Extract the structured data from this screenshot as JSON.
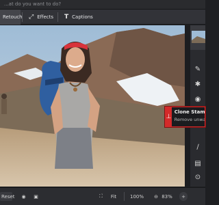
{
  "search": {
    "placeholder": "...at do you want to do?"
  },
  "tabs": [
    {
      "label": "Retouch",
      "icon": "retouch-icon"
    },
    {
      "label": "Effects",
      "icon": "magic-wand-icon"
    },
    {
      "label": "Captions",
      "icon": "text-icon"
    }
  ],
  "tools": [
    {
      "name": "pin-tool",
      "glyph": "✎"
    },
    {
      "name": "sticker-tool",
      "glyph": "✱"
    },
    {
      "name": "eye-tool",
      "glyph": "◉"
    },
    {
      "name": "clone-stamp-tool",
      "glyph": "⊥"
    },
    {
      "name": "brush-tool",
      "glyph": "∕"
    },
    {
      "name": "panel-tool",
      "glyph": "▤"
    },
    {
      "name": "rotate-tool",
      "glyph": "⊙"
    }
  ],
  "tooltip": {
    "title": "Clone Stamp",
    "desc": "Remove unwanted objects",
    "icon": "stamp-icon"
  },
  "bottom": {
    "reset": "Reset",
    "fit": "Fit",
    "hundred": "100%",
    "zoom": "83%"
  },
  "colors": {
    "accent": "#d42a2a",
    "panel": "#2c2d31"
  }
}
